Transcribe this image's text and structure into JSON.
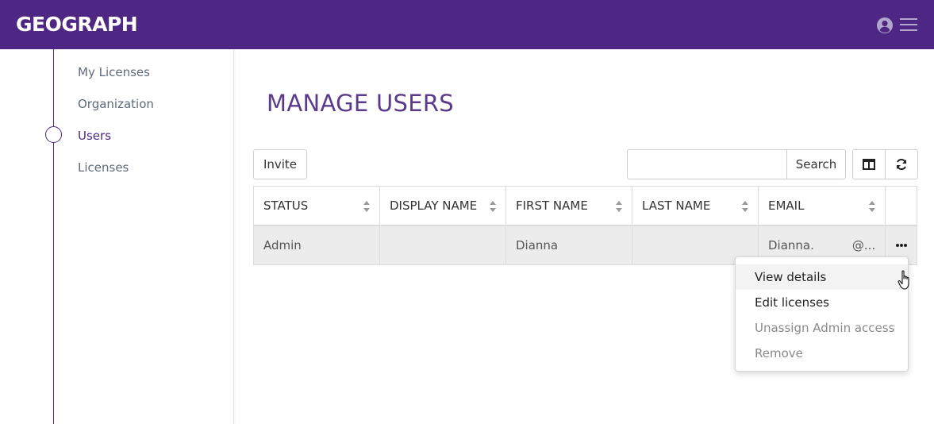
{
  "header": {
    "logo": "GEOGRAPH",
    "bg_color": "#4d2783",
    "icons": [
      "user-circle-icon",
      "hamburger-menu-icon"
    ]
  },
  "sidebar": {
    "items": [
      {
        "label": "My Licenses",
        "active": false
      },
      {
        "label": "Organization",
        "active": false
      },
      {
        "label": "Users",
        "active": true
      },
      {
        "label": "Licenses",
        "active": false
      }
    ]
  },
  "main": {
    "title": "MANAGE USERS",
    "invite_label": "Invite",
    "search": {
      "value": "",
      "placeholder": "",
      "button_label": "Search"
    },
    "toolbar_icons": [
      "columns-icon",
      "refresh-icon"
    ],
    "table": {
      "columns": [
        "STATUS",
        "DISPLAY NAME",
        "FIRST NAME",
        "LAST NAME",
        "EMAIL"
      ],
      "rows": [
        {
          "status": "Admin",
          "display_name": "",
          "first_name": "Dianna",
          "last_name": "",
          "email": "Dianna.",
          "email_domain": "@..."
        }
      ]
    },
    "row_menu": {
      "items": [
        {
          "label": "View details",
          "disabled": false
        },
        {
          "label": "Edit licenses",
          "disabled": false
        },
        {
          "label": "Unassign Admin access",
          "disabled": true
        },
        {
          "label": "Remove",
          "disabled": true
        }
      ]
    }
  }
}
